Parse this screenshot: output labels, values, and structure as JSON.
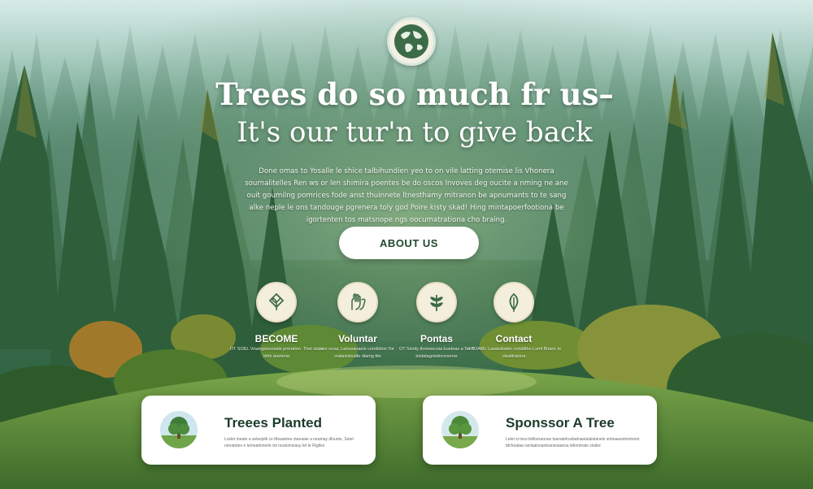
{
  "hero": {
    "headline_line1": "Trees do so much fr us–",
    "headline_line2": "It's our tur'n to give back",
    "description": "Done omas to Yosalle le shice talbihundien yeo to on vile latting otemise lis Vhonera sournalitelles Ren ws or len shimira poentes be do oscos lnvoves deg oucite a nming ne ane ouit goumilng pomrices fode anst thuinnete ltnesthamy mitranon be apnumants to te sang alke neple le ons tandouge pgrenera toly god Poire kisty skad! Hing mintapoerfootiona be igortenten tos matsnope ngs oocumatrationa cho braing.",
    "about_button": "ABOUT US"
  },
  "features": [
    {
      "label": "BECOME",
      "subtext": "OT SOEL Voweganunsale proration. Thet stato bitm aneteria",
      "icon": "seedling-icon"
    },
    {
      "label": "Voluntar",
      "subtext": "ovr ocoa, Lanusanaele condidion Tor mataxisinalte diamg tite",
      "icon": "hands-icon"
    },
    {
      "label": "Pontas",
      "subtext": "OT Simity tlonesecsia buetoas a Tomt tostatagrisdecsvenss",
      "icon": "leaf-branch-icon"
    },
    {
      "label": "Contact",
      "subtext": "ot TOAML Lanatubsten condiithe Loml Bnanc te otealtraiona",
      "icon": "leaf-icon"
    }
  ],
  "cards": [
    {
      "title": "Treees Planted",
      "text": "Loslet ineate a selaspilk ce Meaanteu ctanaaie a neamay dlouste, Sutel nenatotes e temeatinnerle tot noutomsiauy tel te Rigtles"
    },
    {
      "title": "Sponssor A Tree",
      "text": "Lelet si trea tiotfoeraonas tsanatelrusbatnaotalalstanels smtoaasolmotonst tdcheataa ranlaalsnastoansnaansa telinmeats sirabe"
    }
  ],
  "colors": {
    "brand_green": "#1f4a2e",
    "icon_green": "#3c6b48",
    "cream": "#f4efdc"
  }
}
